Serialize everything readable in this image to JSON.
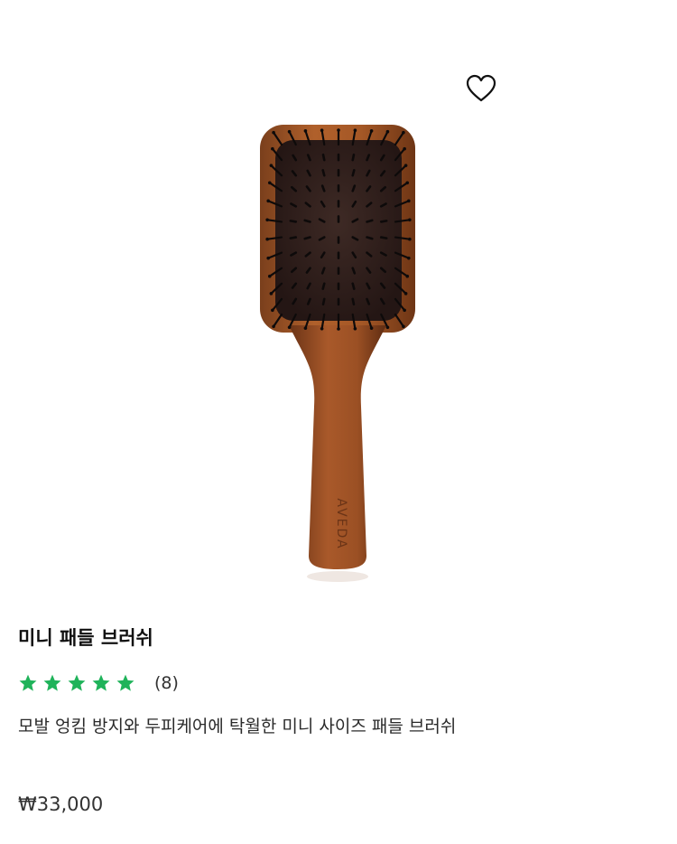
{
  "product": {
    "image_alt": "mini paddle brush",
    "brand_mark": "AVEDA",
    "wishlist_icon": "heart-outline-icon",
    "title": "미니 패들 브러쉬",
    "rating": {
      "stars": 5,
      "max_stars": 5,
      "count_label": "(8)",
      "star_color": "#1fb35a"
    },
    "description": "모발 엉킴 방지와 두피케어에 탁월한 미니 사이즈 패들 브러쉬",
    "price": "₩33,000"
  }
}
